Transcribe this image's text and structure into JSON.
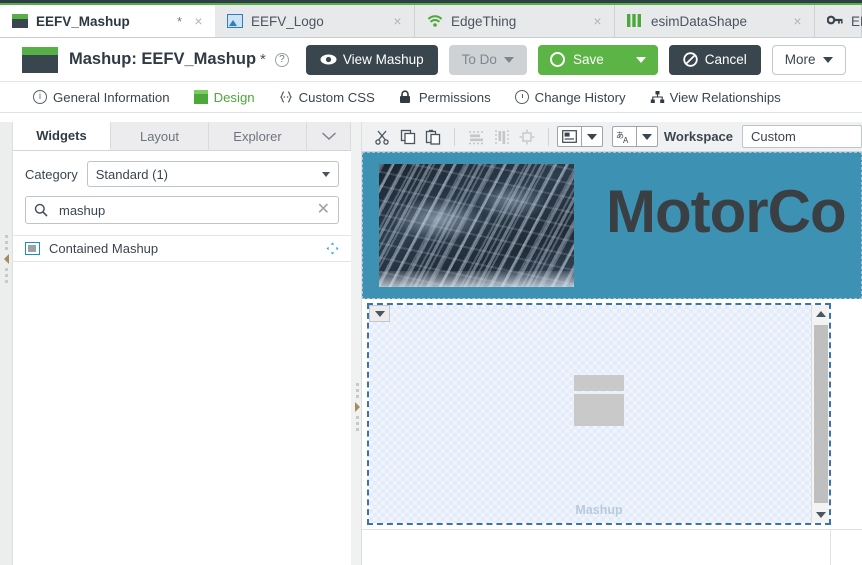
{
  "tabs": [
    {
      "label": "EEFV_Mashup",
      "icon": "mashup-icon",
      "dirty": "*",
      "close": "×",
      "active": true
    },
    {
      "label": "EEFV_Logo",
      "icon": "image-icon",
      "dirty": "",
      "close": "×",
      "active": false
    },
    {
      "label": "EdgeThing",
      "icon": "wifi-icon",
      "dirty": "",
      "close": "×",
      "active": false
    },
    {
      "label": "esimDataShape",
      "icon": "datashape-icon",
      "dirty": "",
      "close": "×",
      "active": false
    },
    {
      "label": "EMS",
      "icon": "key-icon",
      "dirty": "",
      "close": "",
      "active": false
    }
  ],
  "header": {
    "title": "Mashup: EEFV_Mashup",
    "dirty_marker": "*",
    "help_icon": "?",
    "view_mashup": "View Mashup",
    "todo": "To Do",
    "save": "Save",
    "cancel": "Cancel",
    "more": "More"
  },
  "nav": [
    {
      "label": "General Information",
      "icon": "info-icon",
      "selected": false
    },
    {
      "label": "Design",
      "icon": "design-icon",
      "selected": true
    },
    {
      "label": "Custom CSS",
      "icon": "braces-icon",
      "selected": false
    },
    {
      "label": "Permissions",
      "icon": "lock-icon",
      "selected": false
    },
    {
      "label": "Change History",
      "icon": "clock-icon",
      "selected": false
    },
    {
      "label": "View Relationships",
      "icon": "relationships-icon",
      "selected": false
    }
  ],
  "left_panel": {
    "tabs": [
      {
        "label": "Widgets",
        "active": true
      },
      {
        "label": "Layout",
        "active": false
      },
      {
        "label": "Explorer",
        "active": false
      }
    ],
    "expander_icon": "chevron-down-icon",
    "category_label": "Category",
    "category_value": "Standard (1)",
    "search_value": "mashup",
    "search_placeholder": "",
    "search_icon": "search-icon",
    "clear_icon": "clear-icon",
    "widgets": [
      {
        "label": "Contained Mashup",
        "icon": "contained-mashup-icon",
        "handle": "move-handle-icon"
      }
    ]
  },
  "canvas_toolbar": {
    "cut": "cut-icon",
    "copy": "copy-icon",
    "paste": "paste-icon",
    "align_horizontal": "align-horizontal-icon",
    "align_vertical": "align-vertical-icon",
    "align_center": "align-center-icon",
    "layout_dropdown": "layout-icon",
    "language_dropdown": "language-icon",
    "workspace_label": "Workspace",
    "workspace_value": "Custom"
  },
  "canvas": {
    "banner_title": "MotorCo",
    "banner_color": "#3d91b3",
    "banner_image_alt": "engine-photo",
    "contained_mashup": {
      "placeholder_label": "Mashup",
      "dropdown_icon": "chevron-down-icon",
      "scroll_up_icon": "scroll-up-icon",
      "scroll_down_icon": "scroll-down-icon"
    }
  }
}
